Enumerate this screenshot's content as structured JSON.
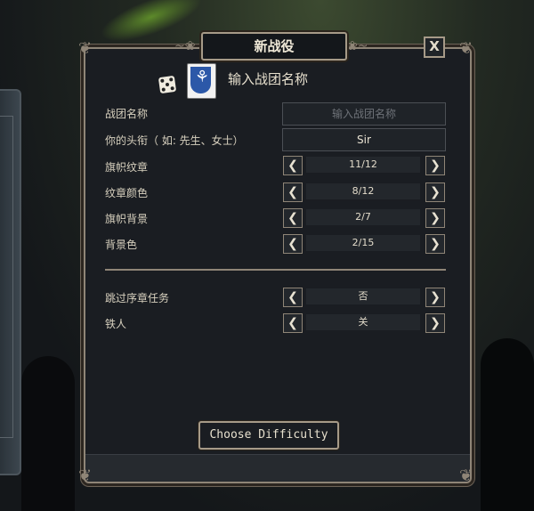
{
  "dialog": {
    "title": "新战役",
    "close_label": "X",
    "company_name_header": "输入战团名称",
    "finish_button": "Choose Difficulty"
  },
  "fields": {
    "company_name": {
      "label": "战团名称",
      "placeholder": "输入战团名称",
      "value": ""
    },
    "title": {
      "label": "你的头衔（ 如: 先生、女士）",
      "value": "Sir"
    }
  },
  "steppers": [
    {
      "label": "旗帜纹章",
      "value": "11/12"
    },
    {
      "label": "纹章颜色",
      "value": "8/12"
    },
    {
      "label": "旗帜背景",
      "value": "2/7"
    },
    {
      "label": "背景色",
      "value": "2/15"
    }
  ],
  "options": [
    {
      "label": "跳过序章任务",
      "value": "否"
    },
    {
      "label": "铁人",
      "value": "关"
    }
  ],
  "colors": {
    "accent_border": "#8f8577",
    "panel_bg": "#1a1d22",
    "banner_blue": "#2c58a8"
  },
  "icons": [
    "dice-icon",
    "banner-icon",
    "arrow-left-icon",
    "arrow-right-icon",
    "close-icon"
  ]
}
